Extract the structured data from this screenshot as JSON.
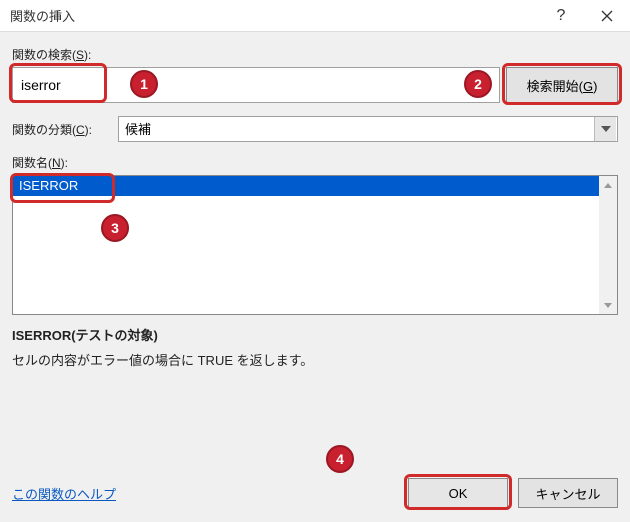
{
  "window": {
    "title": "関数の挿入"
  },
  "labels": {
    "search_prefix": "関数の検索(",
    "search_key": "S",
    "search_suffix": "):",
    "category_prefix": "関数の分類(",
    "category_key": "C",
    "category_suffix": "):",
    "funcname_prefix": "関数名(",
    "funcname_key": "N",
    "funcname_suffix": "):"
  },
  "search": {
    "value": "iserror",
    "button_prefix": "検索開始(",
    "button_key": "G",
    "button_suffix": ")"
  },
  "category": {
    "selected": "候補"
  },
  "functions": {
    "items": [
      "ISERROR"
    ]
  },
  "details": {
    "syntax": "ISERROR(テストの対象)",
    "description": "セルの内容がエラー値の場合に TRUE を返します。"
  },
  "footer": {
    "help_link": "この関数のヘルプ",
    "ok": "OK",
    "cancel": "キャンセル"
  },
  "annotations": {
    "b1": "1",
    "b2": "2",
    "b3": "3",
    "b4": "4"
  }
}
